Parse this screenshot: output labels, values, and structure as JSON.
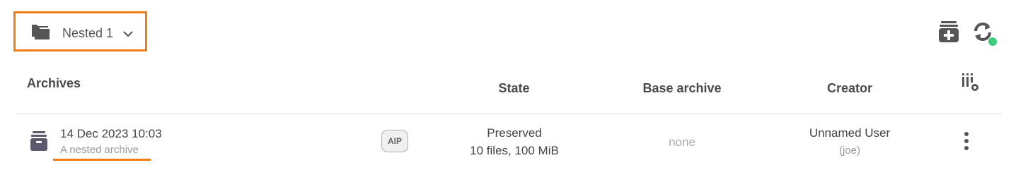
{
  "dataset_selector": {
    "label": "Nested 1",
    "icon": "folder-stack-icon"
  },
  "toolbar": {
    "create_icon": "create-archive-icon",
    "sync_icon": "sync-icon",
    "sync_status_color": "#3ccd7c"
  },
  "table": {
    "headers": {
      "archives": "Archives",
      "state": "State",
      "base_archive": "Base archive",
      "creator": "Creator"
    },
    "rows": [
      {
        "date": "14 Dec 2023 10:03",
        "comment": "A nested archive",
        "badge": "AIP",
        "state_line1": "Preserved",
        "state_line2": "10 files, 100 MiB",
        "base_archive": "none",
        "creator_name": "Unnamed User",
        "creator_username": "(joe)"
      }
    ]
  },
  "colors": {
    "accent": "#f07c16",
    "status_ok": "#3ccd7c",
    "icon": "#555555"
  }
}
